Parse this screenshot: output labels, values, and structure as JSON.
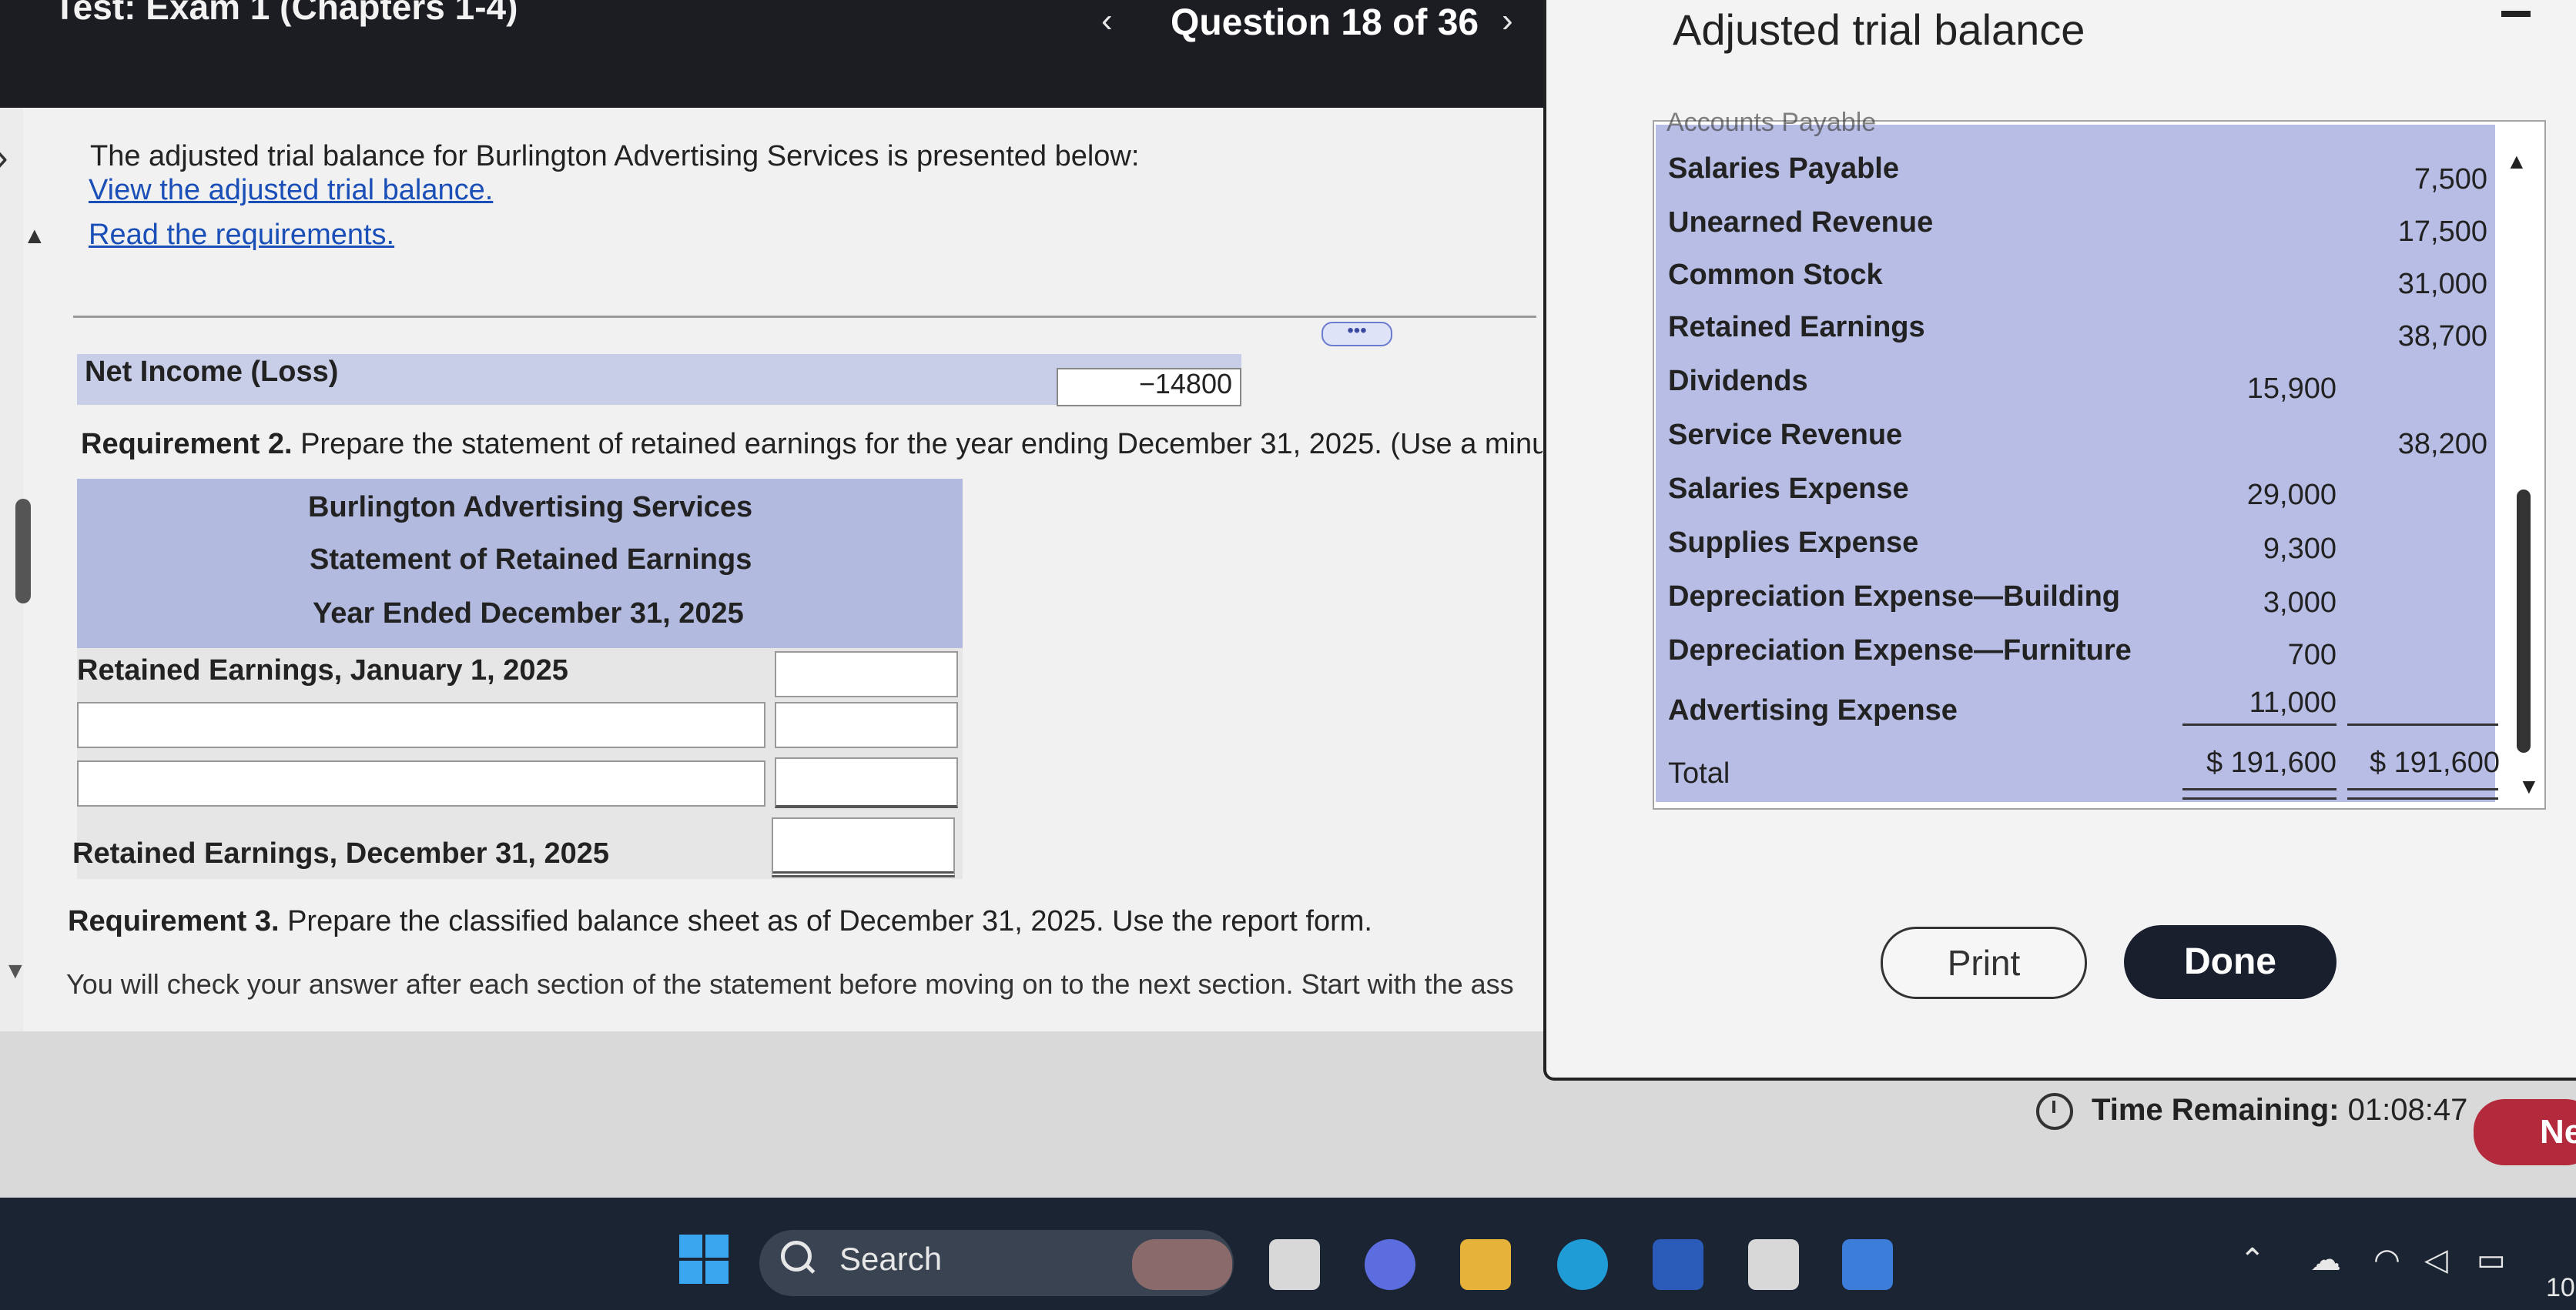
{
  "header": {
    "test_title": "Test: Exam 1 (Chapters 1-4)",
    "question_label": "Question 18 of 36",
    "prev_glyph": "‹",
    "next_glyph": "›"
  },
  "problem": {
    "intro": "The adjusted trial balance for Burlington Advertising Services is presented below:",
    "link_view": "View the adjusted trial balance.",
    "link_requirements": "Read the requirements.",
    "more_glyph": "•••",
    "net_income_label": "Net Income (Loss)",
    "net_income_value": "−14800",
    "req2_prefix": "Requirement 2.",
    "req2_text": " Prepare the statement of retained earnings for the year ending December 31, 2025. (Use a minus sig",
    "statement": {
      "company": "Burlington Advertising Services",
      "title": "Statement of Retained Earnings",
      "period": "Year Ended December 31, 2025",
      "re_begin_label": "Retained Earnings, January 1, 2025",
      "re_end_label": "Retained Earnings, December 31, 2025"
    },
    "req3_prefix": "Requirement 3.",
    "req3_text": " Prepare the classified balance sheet as of December 31, 2025. Use the report form.",
    "check_text": "You will check your answer after each section of the statement before moving on to the next section. Start with the ass"
  },
  "popup": {
    "title": "Adjusted trial balance",
    "partial_row": "Accounts Payable",
    "rows": [
      {
        "account": "Salaries Payable",
        "debit": "",
        "credit": "7,500"
      },
      {
        "account": "Unearned Revenue",
        "debit": "",
        "credit": "17,500"
      },
      {
        "account": "Common Stock",
        "debit": "",
        "credit": "31,000"
      },
      {
        "account": "Retained Earnings",
        "debit": "",
        "credit": "38,700"
      },
      {
        "account": "Dividends",
        "debit": "15,900",
        "credit": ""
      },
      {
        "account": "Service Revenue",
        "debit": "",
        "credit": "38,200"
      },
      {
        "account": "Salaries Expense",
        "debit": "29,000",
        "credit": ""
      },
      {
        "account": "Supplies Expense",
        "debit": "9,300",
        "credit": ""
      },
      {
        "account": "Depreciation Expense—Building",
        "debit": "3,000",
        "credit": ""
      },
      {
        "account": "Depreciation Expense—Furniture",
        "debit": "700",
        "credit": ""
      },
      {
        "account": "Advertising Expense",
        "debit": "11,000",
        "credit": ""
      }
    ],
    "total_label": "Total",
    "total_debit": "$ 191,600",
    "total_credit": "$ 191,600",
    "print_label": "Print",
    "done_label": "Done"
  },
  "footer": {
    "time_label": "Time Remaining:",
    "time_value": "01:08:47",
    "next_label": "Ne"
  },
  "taskbar": {
    "search_label": "Search",
    "clock_partial": "10"
  }
}
